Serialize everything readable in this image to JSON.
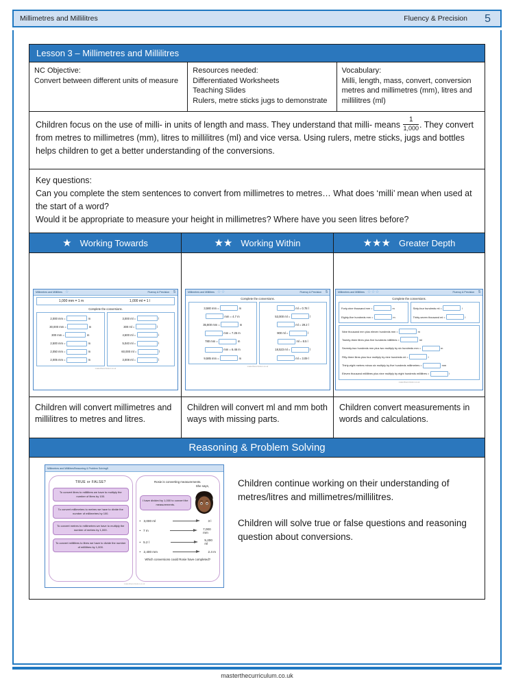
{
  "page_header": {
    "title": "Millimetres and Millilitres",
    "subtitle": "Fluency & Precision",
    "page_number": "5"
  },
  "lesson": {
    "title": "Lesson 3 – Millimetres and Millilitres"
  },
  "info": {
    "objective_label": "NC Objective:",
    "objective_text": "Convert between different units of measure",
    "resources_label": "Resources needed:",
    "resources_items": [
      "Differentiated Worksheets",
      "Teaching Slides",
      "Rulers, metre sticks jugs to demonstrate"
    ],
    "vocabulary_label": "Vocabulary:",
    "vocabulary_text": "Milli, length, mass, convert, conversion metres and millimetres (mm), litres and millilitres (ml)"
  },
  "overview": {
    "part1": "Children focus on the use of milli- in units of length and mass. They understand that milli- means",
    "fraction_numerator": "1",
    "fraction_denominator": "1,000",
    "part2": ". They convert from metres to millimetres (mm), litres to millilitres (ml) and vice versa. Using rulers, metre sticks, jugs and bottles helps children to get a better understanding of the conversions."
  },
  "key_questions": {
    "label": "Key questions:",
    "q1": "Can you complete the stem sentences to convert from millimetres to metres… What does ‘milli’ mean when used at the start of a word?",
    "q2": "Would it be appropriate to measure your height in millimetres? Where have you seen litres before?"
  },
  "differentiation": {
    "columns": [
      {
        "label": "Working Towards",
        "stars": "★",
        "description": "Children will convert millimetres and millilitres to metres and litres."
      },
      {
        "label": "Working Within",
        "stars": "★★",
        "description": "Children will convert ml and mm both ways with missing parts."
      },
      {
        "label": "Greater Depth",
        "stars": "★★★",
        "description": "Children convert measurements in words and calculations."
      }
    ]
  },
  "worksheet1": {
    "header_title": "Millimetres and Millilitres",
    "header_stars": "☆",
    "header_right": "Fluency & Precision",
    "header_num": "5",
    "stem_left": "1,000 mm = 1 m",
    "stem_right": "1,000 ml = 1 l",
    "instruction": "Complete the conversions.",
    "left_items": [
      {
        "value": "2,000 mm =",
        "unit": "m"
      },
      {
        "value": "30,000 mm =",
        "unit": "m"
      },
      {
        "value": "300 mm =",
        "unit": "m"
      },
      {
        "value": "2,500 mm =",
        "unit": "m"
      },
      {
        "value": "2,050 mm =",
        "unit": "m"
      },
      {
        "value": "2,005 mm =",
        "unit": "m"
      }
    ],
    "right_items": [
      {
        "value": "3,000 ml =",
        "unit": "l"
      },
      {
        "value": "300 ml =",
        "unit": "l"
      },
      {
        "value": "4,500 ml =",
        "unit": "l"
      },
      {
        "value": "5,040 ml =",
        "unit": "l"
      },
      {
        "value": "60,000 ml =",
        "unit": "l"
      },
      {
        "value": "3,008 ml =",
        "unit": "l"
      }
    ],
    "footer": "masterthecurriculum.co.uk"
  },
  "worksheet2": {
    "header_title": "Millimetres and Millilitres",
    "header_stars": "☆☆",
    "header_right": "Fluency & Precision",
    "header_num": "5",
    "instruction": "Complete the conversions.",
    "left_items": [
      {
        "pre": "3,580 mm =",
        "post": "m",
        "box_first": false
      },
      {
        "pre": "",
        "post": "mm = 4.7 m",
        "box_first": true
      },
      {
        "pre": "35,800 mm =",
        "post": "m",
        "box_first": false
      },
      {
        "pre": "",
        "post": "mm = 7.25 m",
        "box_first": true
      },
      {
        "pre": "780 mm =",
        "post": "m",
        "box_first": false
      },
      {
        "pre": "",
        "post": "mm = 6.46 m",
        "box_first": true
      },
      {
        "pre": "9,585 mm =",
        "post": "m",
        "box_first": false
      }
    ],
    "right_items": [
      {
        "pre": "",
        "post": "ml = 0.78 l",
        "box_first": true
      },
      {
        "pre": "53,000 ml =",
        "post": "l",
        "box_first": false
      },
      {
        "pre": "",
        "post": "ml = 29.2 l",
        "box_first": true
      },
      {
        "pre": "900 ml =",
        "post": "l",
        "box_first": false
      },
      {
        "pre": "",
        "post": "ml = 8.5 l",
        "box_first": true
      },
      {
        "pre": "18,523 ml =",
        "post": "l",
        "box_first": false
      },
      {
        "pre": "",
        "post": "ml = 3.09 l",
        "box_first": true
      }
    ],
    "footer": "masterthecurriculum.co.uk"
  },
  "worksheet3": {
    "header_title": "Millimetres and Millilitres",
    "header_stars": "☆☆☆",
    "header_right": "Fluency & Precision",
    "header_num": "5",
    "instruction": "Complete the conversions.",
    "top_left": [
      {
        "pre": "Forty-nine thousand mm =",
        "post": "m"
      },
      {
        "pre": "Eighty-five hundreds mm =",
        "post": "m"
      }
    ],
    "top_right": [
      {
        "pre": "Sixty-four hundreds ml =",
        "post": "l"
      },
      {
        "pre": "Thirty-seven thousand ml =",
        "post": "l"
      }
    ],
    "bottom_items": [
      {
        "pre": "Nine thousand mm plus eleven hundreds mm =",
        "post": "m"
      },
      {
        "pre": "Twenty-three litres plus five hundreds millilitres =",
        "post": "ml"
      },
      {
        "pre": "Seventy-two hundreds mm plus two multiply by six hundreds  mm =",
        "post": "m"
      },
      {
        "pre": "Fifty-three litres plus four multiply by nine hundreds ml =",
        "post": "l"
      },
      {
        "pre": "Thirty-eight metres minus six multiply by five hundreds millimetres =",
        "post": "mm"
      },
      {
        "pre": "Eleven thousand millilitres plus nine multiply by eight hundreds millilitres =",
        "post": "l"
      }
    ],
    "footer": "masterthecurriculum.co.uk"
  },
  "reasoning": {
    "header": "Reasoning & Problem Solving",
    "thumb_header_title": "Millimetres and Millilitres",
    "thumb_header_right": "Reasoning & Problem Solving",
    "thumb_header_num": "5",
    "true_false_title": "TRUE  or  FALSE?",
    "true_false_boxes": [
      "To convert litres to millilitres we have to multiply the number of litres by 100.",
      "To convert millimetres to metres we have to divide the number of millimetres by 100.",
      "To convert metres to millimetres we have to multiply the number of metres by 1,000.",
      "To convert millilitres to litres we have to divide the number of millilitres by 1,000."
    ],
    "rosie_intro": "Rosie is converting measurements.",
    "rosie_says": "She says,",
    "rosie_speech": "I have divided by 1,000 to convert the measurements.",
    "conversions": [
      {
        "from": "3,000 ml",
        "to": "3 l"
      },
      {
        "from": "7 m",
        "to": "7,000 mm"
      },
      {
        "from": "5.2 l",
        "to": "5,200 ml"
      },
      {
        "from": "2,400 mm",
        "to": "2.4 m"
      }
    ],
    "closing_question": "Which conversions could Rosie have completed?",
    "thumb_footer": "masterthecurriculum.co.uk",
    "description_p1": "Children continue working on their understanding of metres/litres and millimetres/millilitres.",
    "description_p2": "Children will solve true or false questions and reasoning question about conversions."
  },
  "footer": {
    "text": "masterthecurriculum.co.uk"
  },
  "colors": {
    "brand_blue": "#2b77bd",
    "header_light_blue": "#cfe0f3",
    "border_blue": "#1f78c1",
    "purple": "#e2c9ec"
  }
}
